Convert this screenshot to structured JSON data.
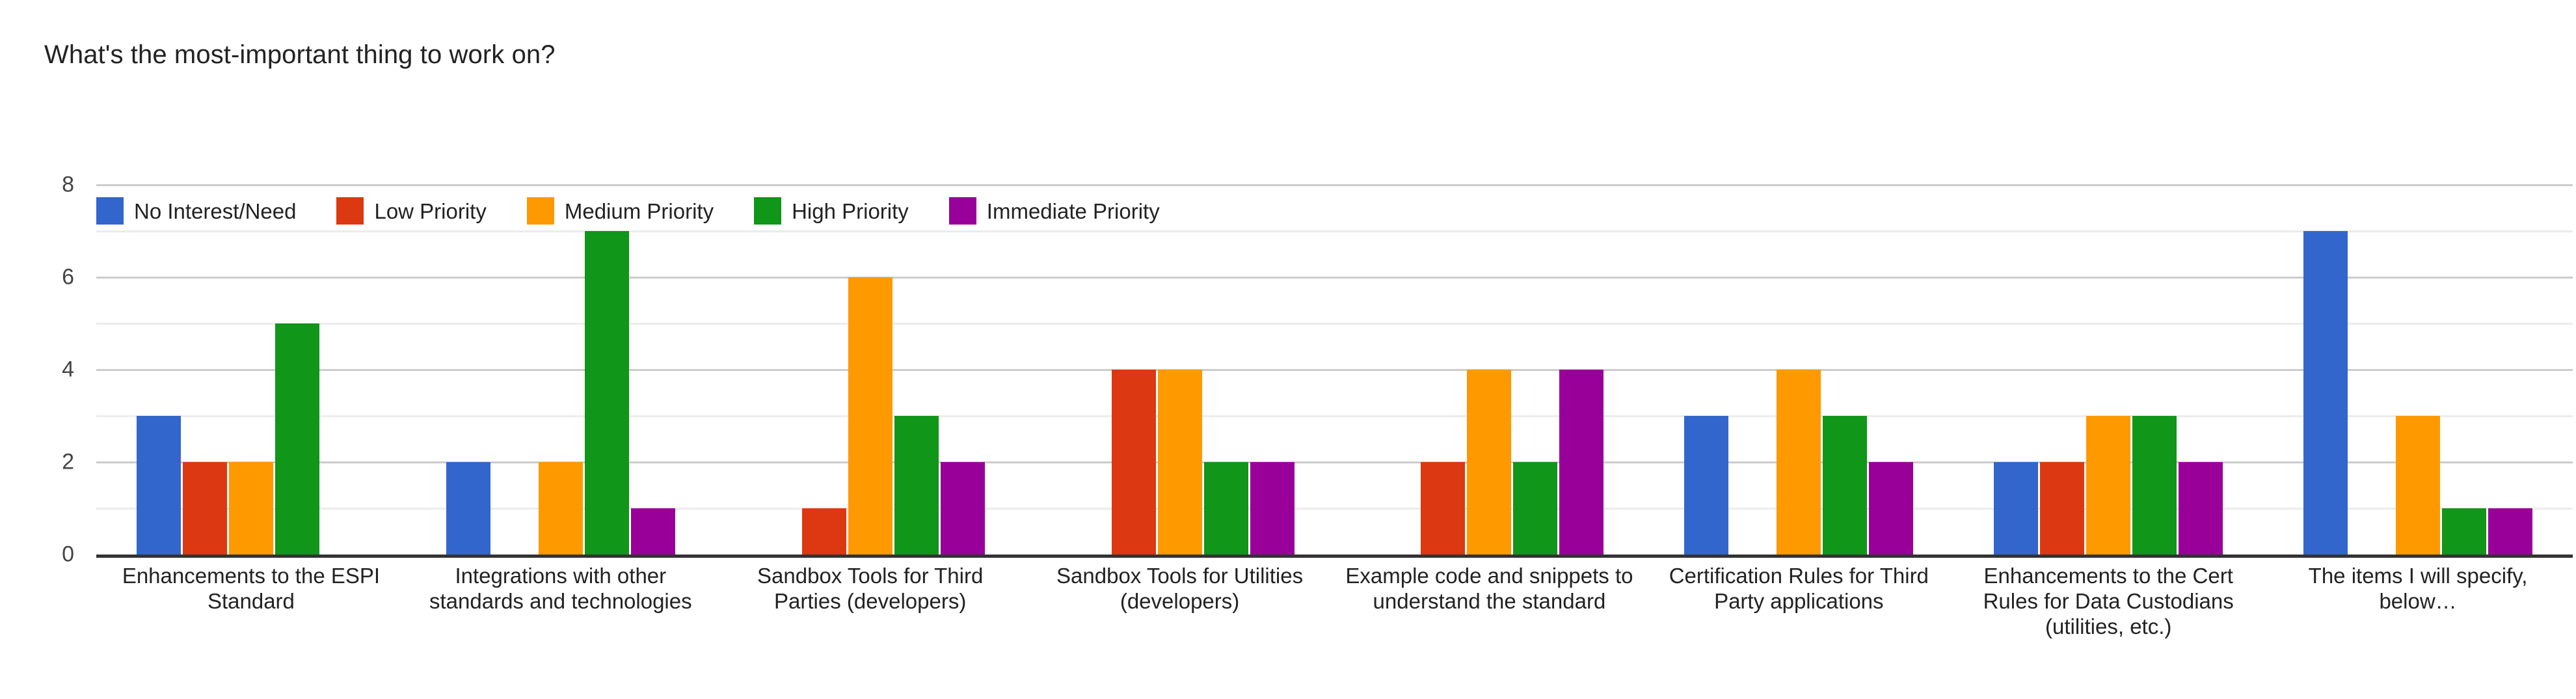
{
  "chart_data": {
    "type": "bar",
    "title": "What's the most-important thing to work on?",
    "xlabel": "",
    "ylabel": "",
    "ylim": [
      0,
      8
    ],
    "yticks": [
      0,
      2,
      4,
      6,
      8
    ],
    "ytick_labels": [
      "0",
      "2",
      "4",
      "6",
      "8"
    ],
    "minor_gridlines": [
      1,
      3,
      5,
      7
    ],
    "grid": true,
    "legend_position": "top-left-inside",
    "orientation": "vertical",
    "grouping": "grouped",
    "categories": [
      "Enhancements to the ESPI Standard",
      "Integrations with other standards and technologies",
      "Sandbox Tools for Third Parties (developers)",
      "Sandbox Tools for Utilities (developers)",
      "Example code and snippets to understand the standard",
      "Certification Rules for Third Party applications",
      "Enhancements to the Cert Rules for Data Custodians (utilities, etc.)",
      "The items I will specify, below…"
    ],
    "series": [
      {
        "name": "No Interest/Need",
        "color": "#3366cc",
        "values": [
          3,
          2,
          0,
          0,
          0,
          3,
          2,
          7
        ]
      },
      {
        "name": "Low Priority",
        "color": "#dc3912",
        "values": [
          2,
          0,
          1,
          4,
          2,
          0,
          2,
          0
        ]
      },
      {
        "name": "Medium Priority",
        "color": "#ff9900",
        "values": [
          2,
          2,
          6,
          4,
          4,
          4,
          3,
          3
        ]
      },
      {
        "name": "High Priority",
        "color": "#109618",
        "values": [
          5,
          7,
          3,
          2,
          2,
          3,
          3,
          1
        ]
      },
      {
        "name": "Immediate Priority",
        "color": "#990099",
        "values": [
          0,
          1,
          2,
          2,
          4,
          2,
          2,
          1
        ]
      }
    ]
  },
  "style": {
    "background": "#ffffff",
    "text_color": "#222222",
    "axis_color": "#333333",
    "gridline_major": "#cccccc",
    "gridline_minor": "#ececec"
  }
}
